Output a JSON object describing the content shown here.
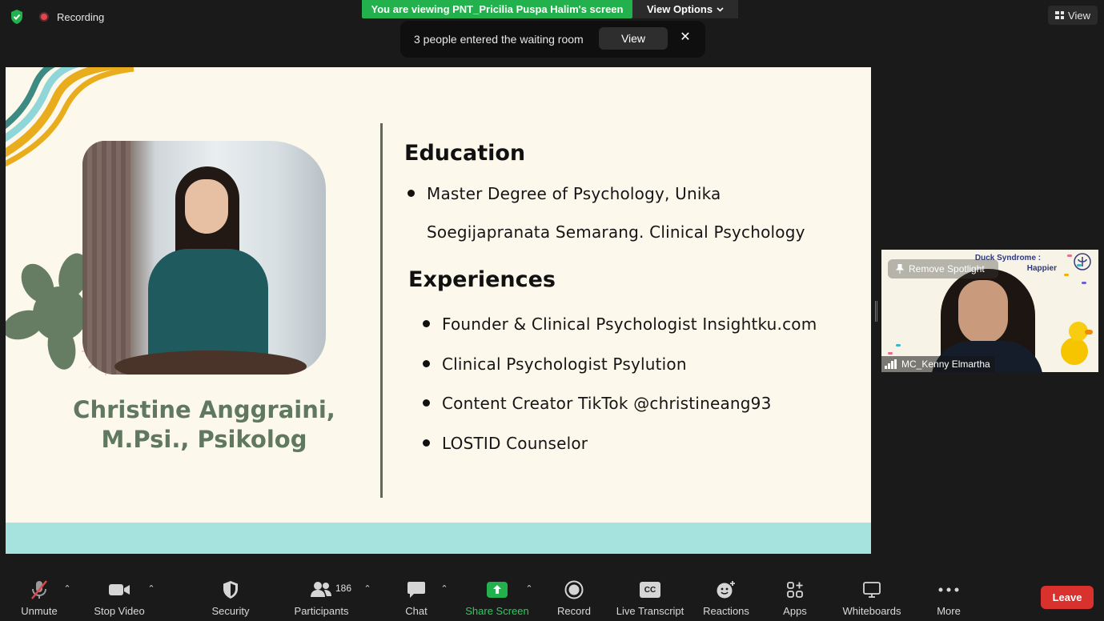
{
  "top": {
    "recording_label": "Recording",
    "viewing_banner": "You are viewing PNT_Pricilia Puspa Halim's screen",
    "view_options_label": "View Options",
    "view_label": "View"
  },
  "waiting_toast": {
    "message": "3 people entered the waiting room",
    "view_button": "View",
    "close_glyph": "✕"
  },
  "slide": {
    "person_name_line1": "Christine Anggraini,",
    "person_name_line2": "M.Psi., Psikolog",
    "education_heading": "Education",
    "education_line1": "Master Degree of Psychology, Unika",
    "education_line2": "Soegijapranata Semarang. Clinical Psychology",
    "experiences_heading": "Experiences",
    "experiences": [
      "Founder & Clinical Psychologist Insightku.com",
      "Clinical Psychologist Psylution",
      "Content Creator TikTok @christineang93",
      "LOSTID Counselor"
    ]
  },
  "spotlight": {
    "title_line1": "Duck Syndrome :",
    "title_line2": "Happier",
    "remove_label": "Remove Spotlight",
    "participant_name": "MC_Kenny Elmartha"
  },
  "toolbar": {
    "unmute": "Unmute",
    "stop_video": "Stop Video",
    "security": "Security",
    "participants": "Participants",
    "participants_count": "186",
    "chat": "Chat",
    "share_screen": "Share Screen",
    "record": "Record",
    "live_transcript": "Live Transcript",
    "reactions": "Reactions",
    "apps": "Apps",
    "whiteboards": "Whiteboards",
    "more": "More",
    "leave": "Leave",
    "cc_glyph": "CC"
  },
  "colors": {
    "green_accent": "#23b14d",
    "leave_red": "#d9322e",
    "slide_bg": "#fdf8ec",
    "band_teal": "#a6e3df",
    "name_green": "#60785f"
  }
}
